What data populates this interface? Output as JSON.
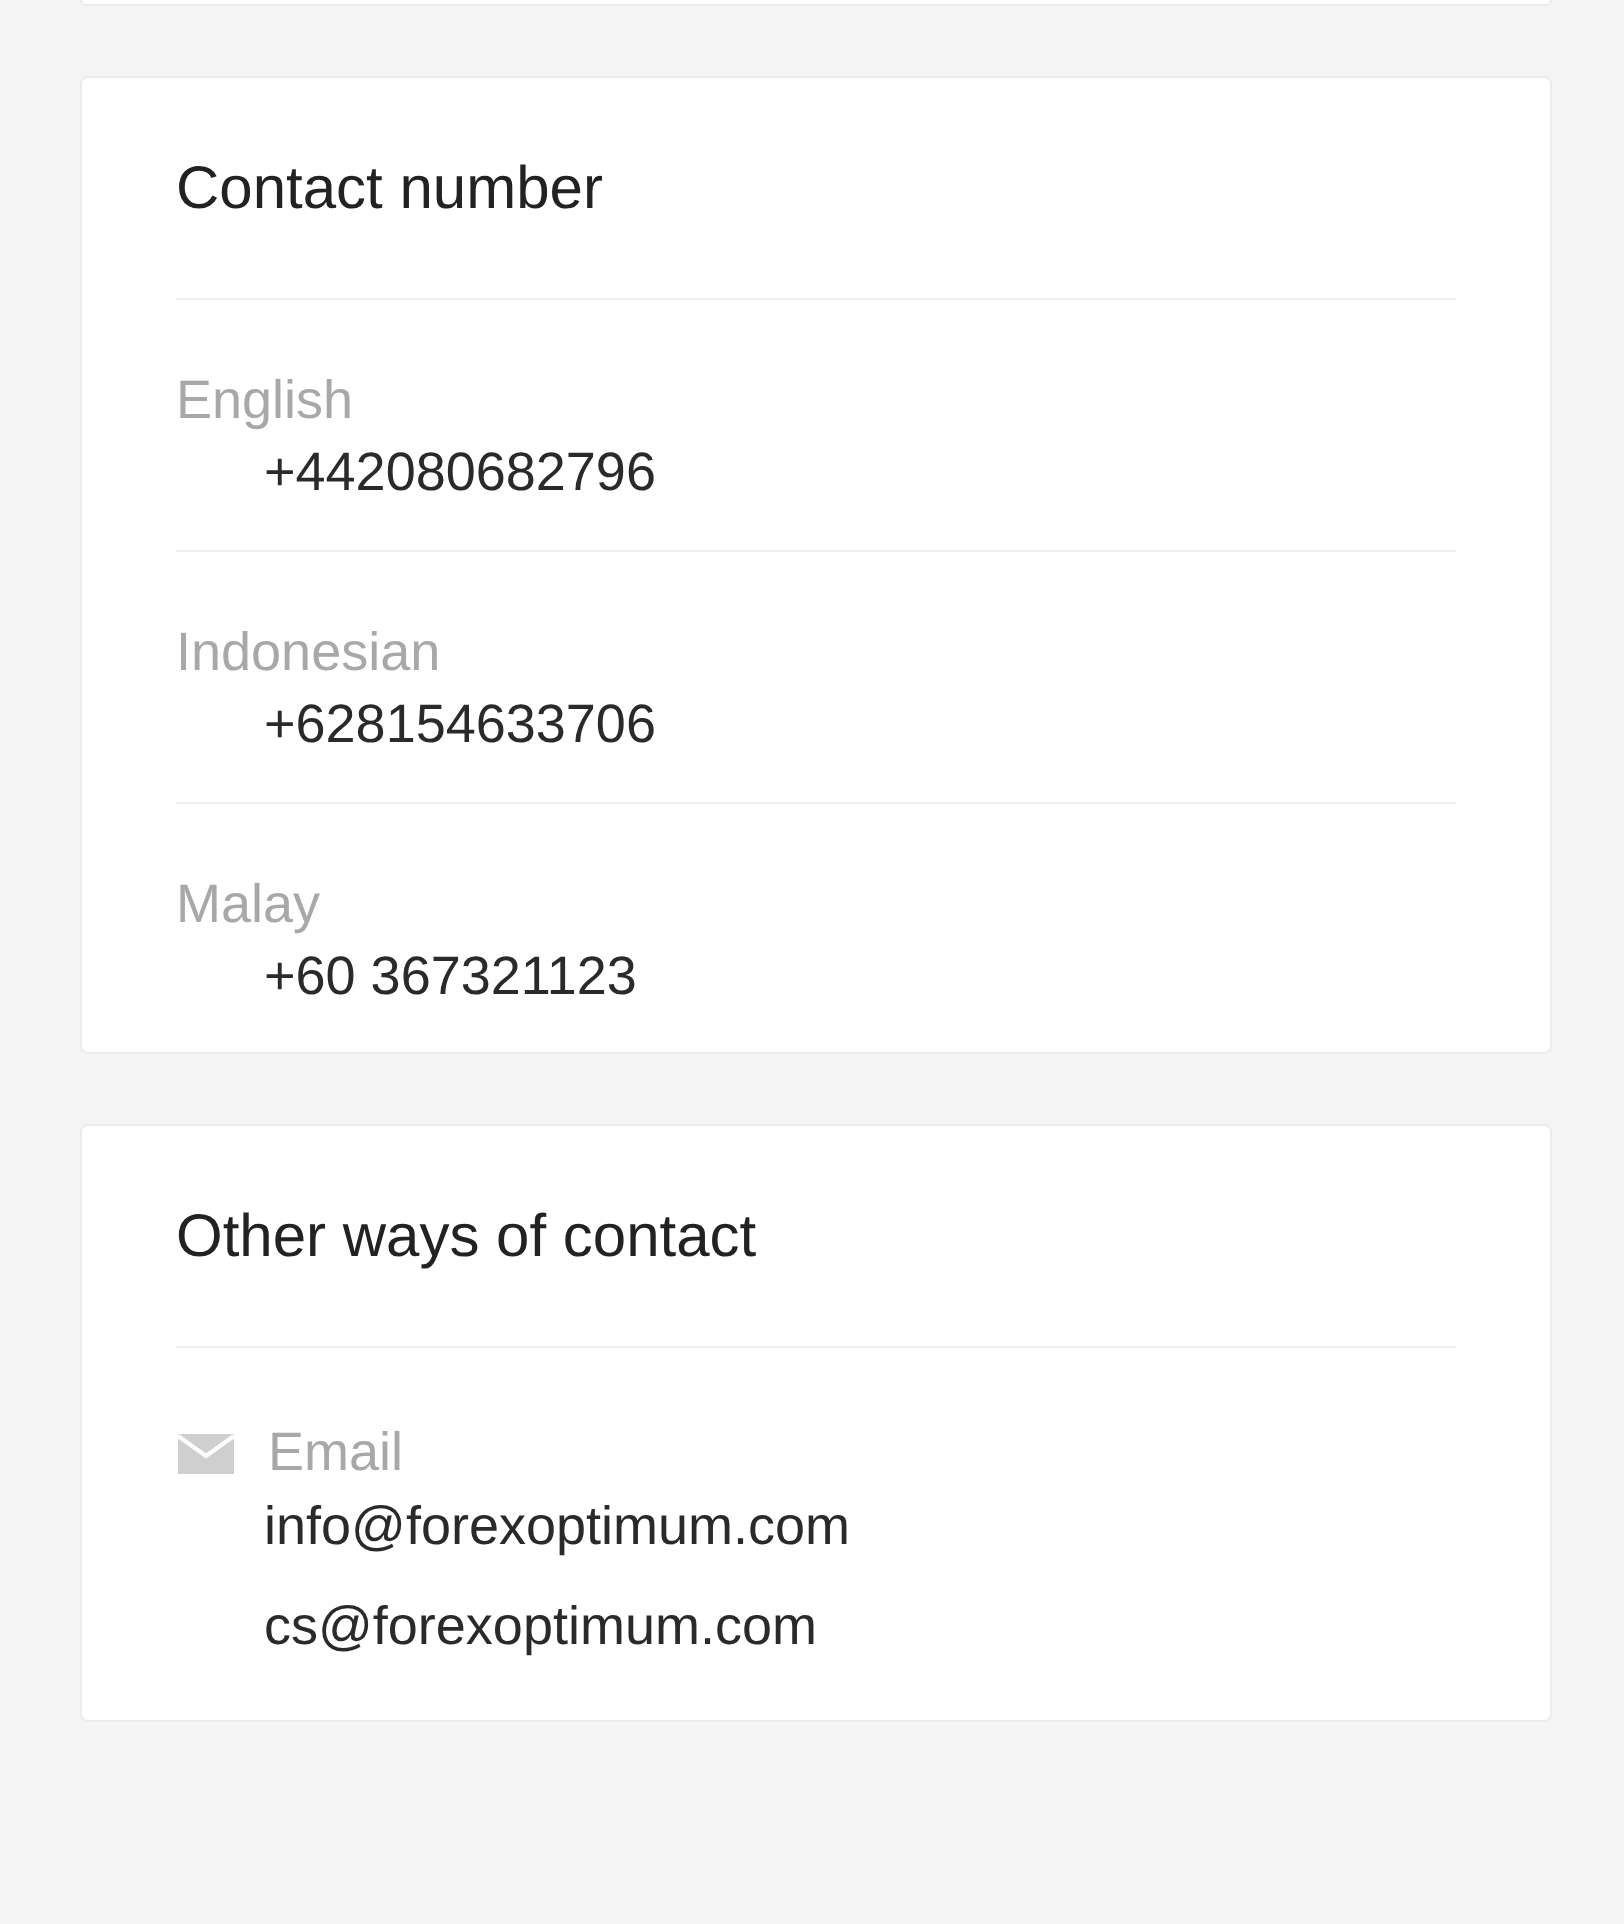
{
  "contact_number": {
    "title": "Contact number",
    "entries": [
      {
        "language": "English",
        "phone": "+442080682796"
      },
      {
        "language": "Indonesian",
        "phone": "+628154633706"
      },
      {
        "language": "Malay",
        "phone": "+60 367321123"
      }
    ]
  },
  "other_contact": {
    "title": "Other ways of contact",
    "methods": [
      {
        "kind": "email",
        "label": "Email",
        "values": [
          "info@forexoptimum.com",
          "cs@forexoptimum.com"
        ]
      }
    ]
  }
}
